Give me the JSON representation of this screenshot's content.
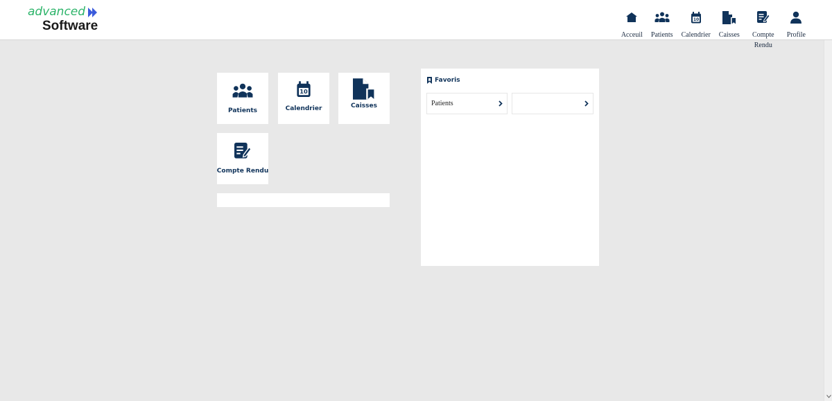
{
  "logo": {
    "top": "advanced",
    "bottom": "Software"
  },
  "nav": [
    {
      "label": "Acceuil",
      "icon": "home-icon"
    },
    {
      "label": "Patients",
      "icon": "patients-icon"
    },
    {
      "label": "Calendrier",
      "icon": "calendar-icon"
    },
    {
      "label": "Caisses",
      "icon": "caisses-icon"
    },
    {
      "label": "Compte Rendu",
      "icon": "report-icon"
    },
    {
      "label": "Profile",
      "icon": "profile-icon"
    }
  ],
  "tiles": [
    {
      "label": "Patients",
      "icon": "patients-icon"
    },
    {
      "label": "Calendrier",
      "icon": "calendar-icon",
      "icon_text": "10"
    },
    {
      "label": "Caisses",
      "icon": "caisses-icon"
    },
    {
      "label": "Compte Rendu",
      "icon": "report-icon"
    }
  ],
  "favoris": {
    "title": "Favoris",
    "items": [
      {
        "label": "Patients"
      },
      {
        "label": ""
      }
    ]
  },
  "colors": {
    "brand_green": "#2db46a",
    "brand_blue": "#3b5bdb",
    "icon_navy": "#10335a",
    "background": "#e8e8e8"
  },
  "calendar_icon_text": "10"
}
